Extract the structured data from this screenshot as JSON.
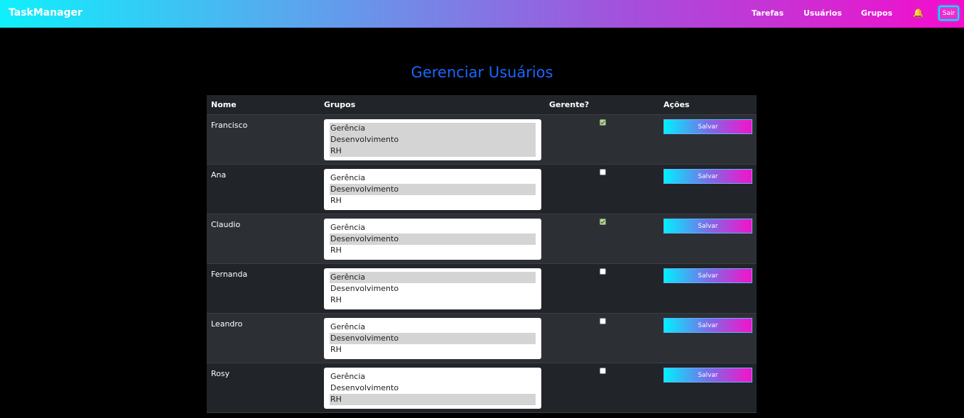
{
  "navbar": {
    "brand": "TaskManager",
    "links": [
      "Tarefas",
      "Usuários",
      "Grupos"
    ],
    "bell_icon": "bell-icon",
    "logout_label": "Sair"
  },
  "page": {
    "title": "Gerenciar Usuários"
  },
  "table": {
    "headers": {
      "name": "Nome",
      "groups": "Grupos",
      "manager": "Gerente?",
      "actions": "Ações"
    },
    "group_options": [
      "Gerência",
      "Desenvolvimento",
      "RH"
    ],
    "save_label": "Salvar",
    "rows": [
      {
        "name": "Francisco",
        "selected": [
          "Gerência",
          "Desenvolvimento",
          "RH"
        ],
        "manager": true
      },
      {
        "name": "Ana",
        "selected": [
          "Desenvolvimento"
        ],
        "manager": false
      },
      {
        "name": "Claudio",
        "selected": [
          "Desenvolvimento"
        ],
        "manager": true
      },
      {
        "name": "Fernanda",
        "selected": [
          "Gerência"
        ],
        "manager": false
      },
      {
        "name": "Leandro",
        "selected": [
          "Desenvolvimento"
        ],
        "manager": false
      },
      {
        "name": "Rosy",
        "selected": [
          "RH"
        ],
        "manager": false
      }
    ]
  }
}
